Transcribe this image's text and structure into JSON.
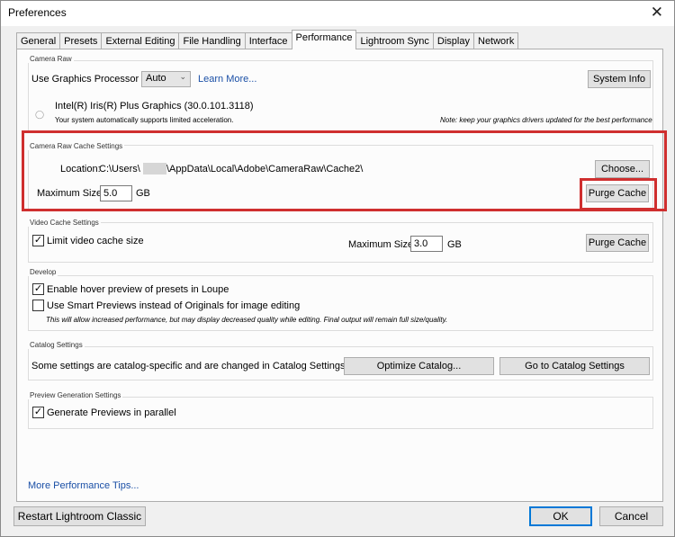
{
  "window": {
    "title": "Preferences",
    "close_glyph": "✕"
  },
  "tabs": [
    {
      "label": "General"
    },
    {
      "label": "Presets"
    },
    {
      "label": "External Editing"
    },
    {
      "label": "File Handling"
    },
    {
      "label": "Interface"
    },
    {
      "label": "Performance",
      "active": true
    },
    {
      "label": "Lightroom Sync"
    },
    {
      "label": "Display"
    },
    {
      "label": "Network"
    }
  ],
  "camera_raw": {
    "header": "Camera Raw",
    "gpu_label": "Use Graphics Processor :",
    "gpu_value": "Auto",
    "learn_more": "Learn More...",
    "system_info": "System Info",
    "gpu_name": "Intel(R) Iris(R) Plus Graphics (30.0.101.3118)",
    "gpu_status": "Your system automatically supports limited acceleration.",
    "note": "Note: keep your graphics drivers updated for the best performance"
  },
  "cache": {
    "header": "Camera Raw Cache Settings",
    "location_label": "Location:",
    "location_prefix": "C:\\Users\\",
    "location_suffix": "\\AppData\\Local\\Adobe\\CameraRaw\\Cache2\\",
    "choose": "Choose...",
    "max_size_label": "Maximum Size:",
    "max_size_value": "5.0",
    "unit": "GB",
    "purge": "Purge Cache"
  },
  "video_cache": {
    "header": "Video Cache Settings",
    "limit_label": "Limit video cache size",
    "limit_checked": true,
    "max_size_label": "Maximum Size:",
    "max_size_value": "3.0",
    "unit": "GB",
    "purge": "Purge Cache"
  },
  "develop": {
    "header": "Develop",
    "hover_label": "Enable hover preview of presets in Loupe",
    "hover_checked": true,
    "smart_label": "Use Smart Previews instead of Originals for image editing",
    "smart_checked": false,
    "smart_note": "This will allow increased performance, but may display decreased quality while editing. Final output will remain full size/quality."
  },
  "catalog": {
    "header": "Catalog Settings",
    "text": "Some settings are catalog-specific and are changed in Catalog Settings.",
    "optimize": "Optimize Catalog...",
    "goto": "Go to Catalog Settings"
  },
  "preview": {
    "header": "Preview Generation Settings",
    "parallel_label": "Generate Previews in parallel",
    "parallel_checked": true
  },
  "footer": {
    "tips_link": "More Performance Tips...",
    "restart": "Restart Lightroom Classic",
    "ok": "OK",
    "cancel": "Cancel"
  },
  "check_glyph": "✓",
  "colors": {
    "highlight_red": "#cf2f2f",
    "link_blue": "#1a4fa6"
  }
}
